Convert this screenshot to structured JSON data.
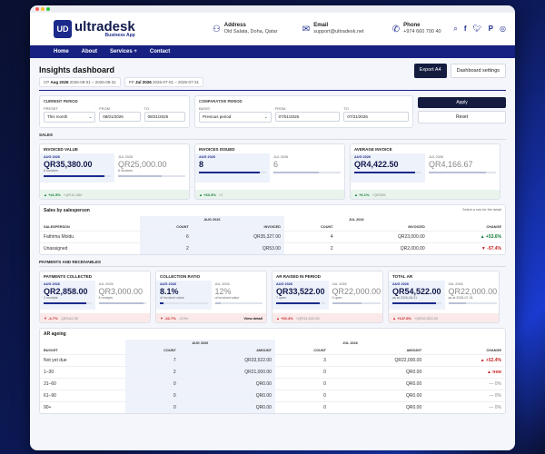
{
  "brand": {
    "name": "ultradesk",
    "subtitle": "Business App",
    "mark": "UD"
  },
  "contact": {
    "address": {
      "title": "Address",
      "value": "Old Salata, Doha, Qatar"
    },
    "email": {
      "title": "Email",
      "value": "support@ultradesk.net"
    },
    "phone": {
      "title": "Phone",
      "value": "+974 660 700 40"
    }
  },
  "nav": {
    "home": "Home",
    "about": "About",
    "services": "Services +",
    "contact": "Contact"
  },
  "page": {
    "title": "Insights dashboard",
    "export_label": "Export A4",
    "settings_label": "Dashboard settings",
    "period_tabs": [
      {
        "prefix": "CP",
        "name": "Aug 2026",
        "range": "2026-08-01 – 2026-08-31"
      },
      {
        "prefix": "PP",
        "name": "Jul 2026",
        "range": "2026-07-01 – 2026-07-31"
      }
    ]
  },
  "filters": {
    "current": {
      "title": "CURRENT PERIOD",
      "preset_label": "PRESET",
      "preset": "This month",
      "from_label": "FROM",
      "from": "08/01/2026",
      "to_label": "TO",
      "to": "08/31/2026"
    },
    "comparative": {
      "title": "COMPARATIVE PERIOD",
      "basis_label": "BASIS",
      "basis": "Previous period",
      "from_label": "FROM",
      "from": "07/01/2026",
      "to_label": "TO",
      "to": "07/31/2026"
    },
    "apply_label": "Apply",
    "reset_label": "Reset"
  },
  "sales": {
    "section_title": "SALES",
    "cards": [
      {
        "title": "INVOICED VALUE",
        "cur_period": "AUG 2026",
        "cur_value": "QR35,380.00",
        "cur_sub": "8 invoices",
        "cur_fill": 0.9,
        "prev_period": "JUL 2026",
        "prev_value": "QR25,000.00",
        "prev_sub": "6 invoices",
        "prev_fill": 0.65,
        "delta": "▲ +41.5%",
        "delta_dir": "up",
        "delta_note": "+QR10,380"
      },
      {
        "title": "INVOICES ISSUED",
        "cur_period": "AUG 2026",
        "cur_value": "8",
        "cur_sub": "",
        "cur_fill": 0.9,
        "prev_period": "JUL 2026",
        "prev_value": "6",
        "prev_sub": "",
        "prev_fill": 0.67,
        "delta": "▲ +33.3%",
        "delta_dir": "up",
        "delta_note": "+2"
      },
      {
        "title": "AVERAGE INVOICE",
        "cur_period": "AUG 2026",
        "cur_value": "QR4,422.50",
        "cur_sub": "",
        "cur_fill": 0.9,
        "prev_period": "JUL 2026",
        "prev_value": "QR4,166.67",
        "prev_sub": "",
        "prev_fill": 0.85,
        "delta": "▲ +6.1%",
        "delta_dir": "up",
        "delta_note": "+QR255"
      }
    ]
  },
  "salesperson": {
    "title": "Sales by salesperson",
    "hint": "Select a row for the detail",
    "group_cur": "AUG 2026",
    "group_prev": "JUL 2026",
    "col_name": "SALESPERSON",
    "col_count": "COUNT",
    "col_invoiced": "INVOICED",
    "col_change": "CHANGE",
    "rows": [
      {
        "name": "Fathima Moidu",
        "cur_count": "6",
        "cur_invoiced": "QR35,327.00",
        "prev_count": "4",
        "prev_invoiced": "QR23,000.00",
        "change": "▲ +53.6%",
        "dir": "up"
      },
      {
        "name": "Unassigned",
        "cur_count": "2",
        "cur_invoiced": "QR53.00",
        "prev_count": "2",
        "prev_invoiced": "QR2,000.00",
        "change": "▼ -97.4%",
        "dir": "down"
      }
    ]
  },
  "payments": {
    "section_title": "PAYMENTS AND RECEIVABLES",
    "cards": [
      {
        "title": "PAYMENTS COLLECTED",
        "cur_period": "AUG 2026",
        "cur_value": "QR2,858.00",
        "cur_sub": "3 receipts",
        "cur_fill": 0.9,
        "prev_period": "JUL 2026",
        "prev_value": "QR3,000.00",
        "prev_sub": "4 receipts",
        "prev_fill": 0.95,
        "delta": "▼ -4.7%",
        "delta_dir": "down",
        "delta_note": "-QR142.00",
        "link": ""
      },
      {
        "title": "COLLECTION RATIO",
        "cur_period": "AUG 2026",
        "cur_value": "8.1%",
        "cur_sub": "of invoiced value",
        "cur_fill": 0.08,
        "prev_period": "JUL 2026",
        "prev_value": "12%",
        "prev_sub": "of invoiced value",
        "prev_fill": 0.12,
        "delta": "▼ -32.7%",
        "delta_dir": "down",
        "delta_note": "-3.9%",
        "link": "View detail"
      },
      {
        "title": "AR RAISED IN PERIOD",
        "cur_period": "AUG 2026",
        "cur_value": "QR33,522.00",
        "cur_sub": "7 open",
        "cur_fill": 0.9,
        "prev_period": "JUL 2026",
        "prev_value": "QR22,000.00",
        "prev_sub": "3 open",
        "prev_fill": 0.6,
        "delta": "▲ +52.4%",
        "delta_dir": "down",
        "delta_note": "+QR11,522.00",
        "link": ""
      },
      {
        "title": "TOTAL AR",
        "cur_period": "AUG 2026",
        "cur_value": "QR54,522.00",
        "cur_sub": "as at 2026-08-31",
        "cur_fill": 0.9,
        "prev_period": "JUL 2026",
        "prev_value": "QR22,000.00",
        "prev_sub": "as at 2026-07-31",
        "prev_fill": 0.37,
        "delta": "▲ +147.8%",
        "delta_dir": "down",
        "delta_note": "+QR32,522.00",
        "link": ""
      }
    ]
  },
  "ageing": {
    "title": "AR ageing",
    "group_cur": "AUG 2026",
    "group_prev": "JUL 2026",
    "col_bucket": "BUCKET",
    "col_count": "COUNT",
    "col_amount": "AMOUNT",
    "col_change": "CHANGE",
    "rows": [
      {
        "bucket": "Not yet due",
        "cur_count": "7",
        "cur_amount": "QR33,522.00",
        "prev_count": "3",
        "prev_amount": "QR22,000.00",
        "change": "▲ +52.4%",
        "dir": "down"
      },
      {
        "bucket": "1–30",
        "cur_count": "2",
        "cur_amount": "QR21,000.00",
        "prev_count": "0",
        "prev_amount": "QR0.00",
        "change": "▲ new",
        "dir": "down"
      },
      {
        "bucket": "31–60",
        "cur_count": "0",
        "cur_amount": "QR0.00",
        "prev_count": "0",
        "prev_amount": "QR0.00",
        "change": "— 0%",
        "dir": "flat"
      },
      {
        "bucket": "61–90",
        "cur_count": "0",
        "cur_amount": "QR0.00",
        "prev_count": "0",
        "prev_amount": "QR0.00",
        "change": "— 0%",
        "dir": "flat"
      },
      {
        "bucket": "90+",
        "cur_count": "0",
        "cur_amount": "QR0.00",
        "prev_count": "0",
        "prev_amount": "QR0.00",
        "change": "— 0%",
        "dir": "flat"
      }
    ]
  },
  "colors": {
    "navy": "#172182",
    "up": "#147a3a",
    "down": "#c62828"
  }
}
